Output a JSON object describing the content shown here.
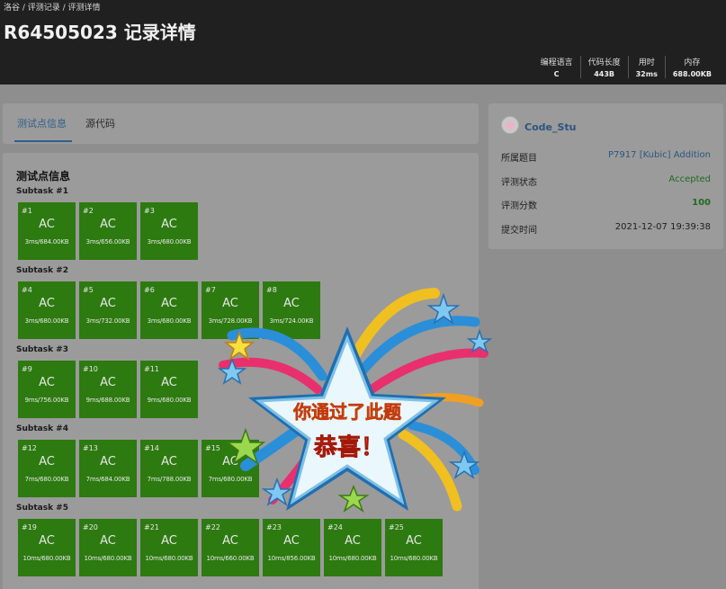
{
  "header": {
    "breadcrumb": "洛谷 / 评测记录 / 评测详情",
    "title": "R64505023 记录详情",
    "stats": [
      {
        "label": "编程语言",
        "value": "C"
      },
      {
        "label": "代码长度",
        "value": "443B"
      },
      {
        "label": "用时",
        "value": "32ms"
      },
      {
        "label": "内存",
        "value": "688.00KB"
      }
    ]
  },
  "tabs": {
    "testcases": "测试点信息",
    "source": "源代码"
  },
  "section_title": "测试点信息",
  "subtasks": [
    {
      "name": "Subtask #1",
      "cases": [
        {
          "id": "#1",
          "status": "AC",
          "info": "3ms/684.00KB"
        },
        {
          "id": "#2",
          "status": "AC",
          "info": "3ms/656.00KB"
        },
        {
          "id": "#3",
          "status": "AC",
          "info": "3ms/680.00KB"
        }
      ]
    },
    {
      "name": "Subtask #2",
      "cases": [
        {
          "id": "#4",
          "status": "AC",
          "info": "3ms/680.00KB"
        },
        {
          "id": "#5",
          "status": "AC",
          "info": "3ms/732.00KB"
        },
        {
          "id": "#6",
          "status": "AC",
          "info": "3ms/680.00KB"
        },
        {
          "id": "#7",
          "status": "AC",
          "info": "3ms/728.00KB"
        },
        {
          "id": "#8",
          "status": "AC",
          "info": "3ms/724.00KB"
        }
      ]
    },
    {
      "name": "Subtask #3",
      "cases": [
        {
          "id": "#9",
          "status": "AC",
          "info": "9ms/756.00KB"
        },
        {
          "id": "#10",
          "status": "AC",
          "info": "9ms/688.00KB"
        },
        {
          "id": "#11",
          "status": "AC",
          "info": "9ms/680.00KB"
        }
      ]
    },
    {
      "name": "Subtask #4",
      "cases": [
        {
          "id": "#12",
          "status": "AC",
          "info": "7ms/680.00KB"
        },
        {
          "id": "#13",
          "status": "AC",
          "info": "7ms/684.00KB"
        },
        {
          "id": "#14",
          "status": "AC",
          "info": "7ms/788.00KB"
        },
        {
          "id": "#15",
          "status": "AC",
          "info": "7ms/680.00KB"
        }
      ]
    },
    {
      "name": "Subtask #5",
      "cases": [
        {
          "id": "#19",
          "status": "AC",
          "info": "10ms/680.00KB"
        },
        {
          "id": "#20",
          "status": "AC",
          "info": "10ms/680.00KB"
        },
        {
          "id": "#21",
          "status": "AC",
          "info": "10ms/680.00KB"
        },
        {
          "id": "#22",
          "status": "AC",
          "info": "10ms/660.00KB"
        },
        {
          "id": "#23",
          "status": "AC",
          "info": "10ms/856.00KB"
        },
        {
          "id": "#24",
          "status": "AC",
          "info": "10ms/680.00KB"
        },
        {
          "id": "#25",
          "status": "AC",
          "info": "10ms/680.00KB"
        }
      ]
    }
  ],
  "side": {
    "username": "Code_Stu",
    "rows": [
      {
        "label": "所属题目",
        "value": "P7917 [Kubic] Addition"
      },
      {
        "label": "评测状态",
        "value": "Accepted"
      },
      {
        "label": "评测分数",
        "value": "100"
      },
      {
        "label": "提交时间",
        "value": "2021-12-07 19:39:38"
      }
    ]
  },
  "celebration": {
    "line1": "你通过了此题",
    "line2": "恭喜！"
  },
  "colors": {
    "ac": "#2d7a10",
    "link": "#2b5580",
    "accepted": "#1f6b1f"
  }
}
